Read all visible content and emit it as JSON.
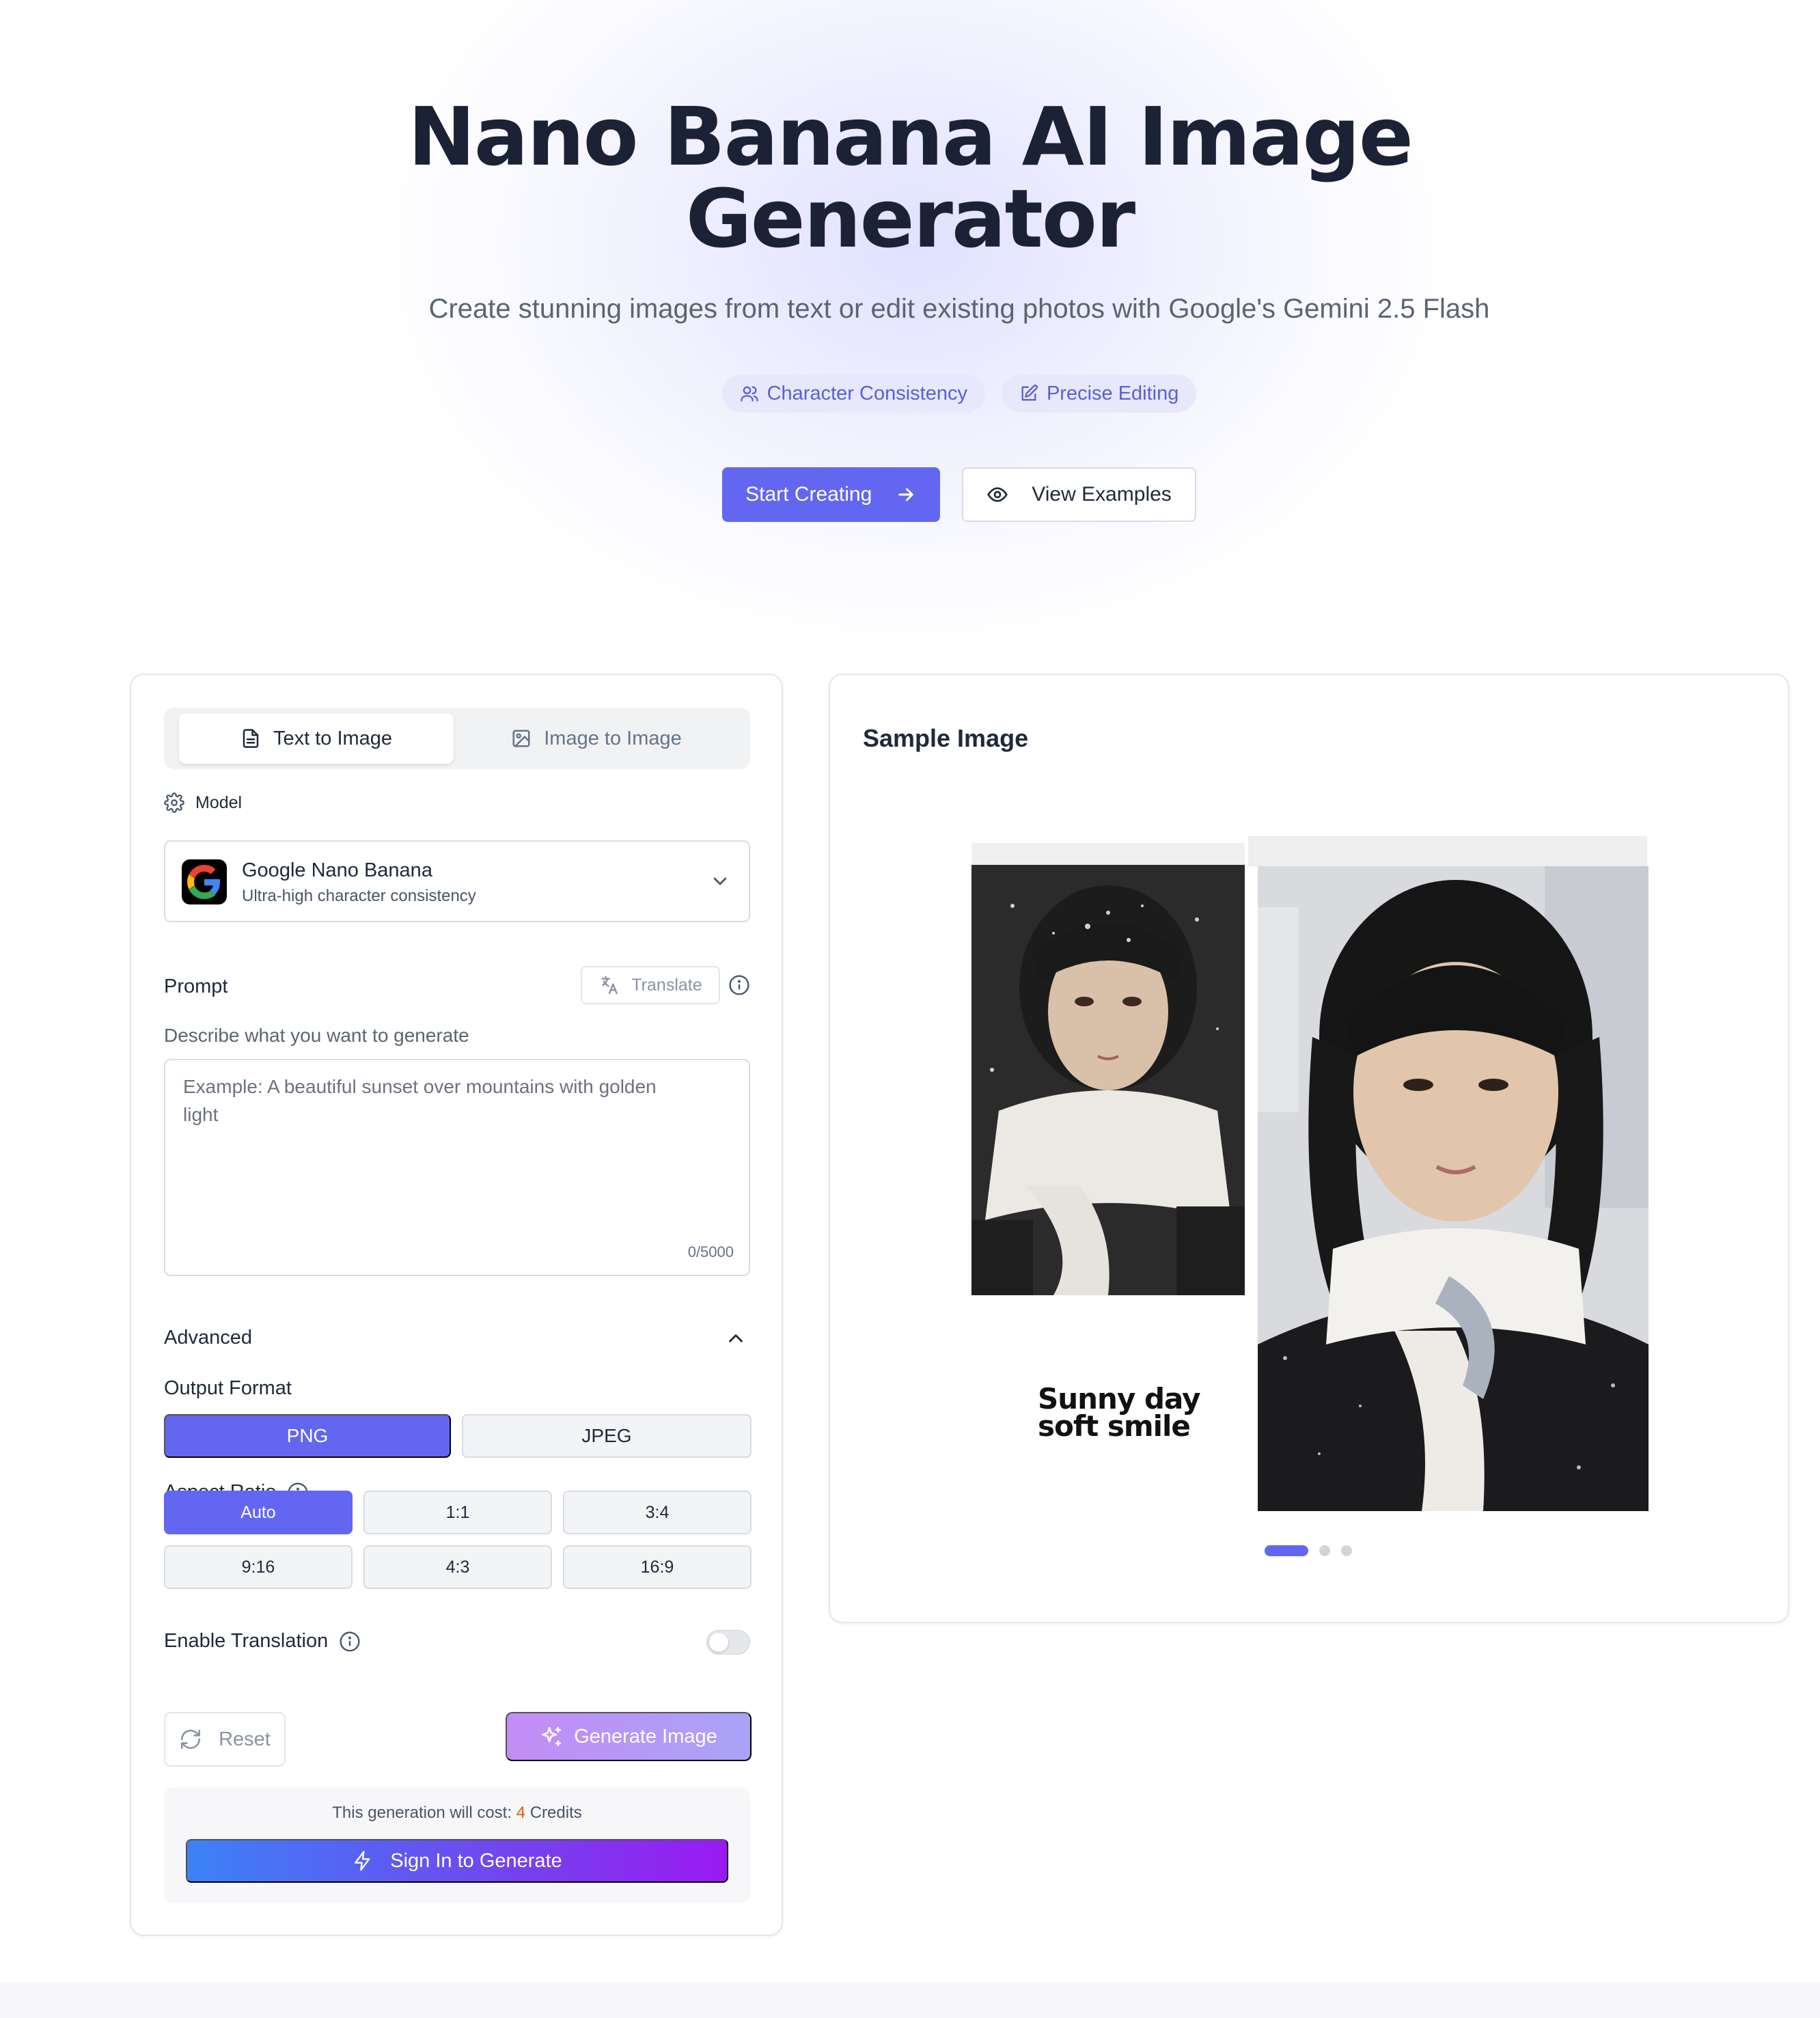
{
  "hero": {
    "title_line1": "Nano Banana AI Image",
    "title_line2": "Generator",
    "subtitle": "Create stunning images from text or edit existing photos with Google's Gemini 2.5 Flash",
    "badges": [
      "Character Consistency",
      "Precise Editing"
    ],
    "start_label": "Start Creating",
    "examples_label": "View Examples"
  },
  "tabs": [
    "Text to Image",
    "Image to Image"
  ],
  "model": {
    "label": "Model",
    "name": "Google Nano Banana",
    "description": "Ultra-high character consistency"
  },
  "prompt": {
    "label": "Prompt",
    "translate_label": "Translate",
    "hint": "Describe what you want to generate",
    "placeholder": "Example: A beautiful sunset over mountains with golden light",
    "counter": "0/5000"
  },
  "advanced": {
    "label": "Advanced",
    "output_format_label": "Output Format",
    "formats": [
      "PNG",
      "JPEG"
    ],
    "selected_format": "PNG",
    "aspect_ratio_label": "Aspect Ratio",
    "aspect_ratios": [
      "Auto",
      "1:1",
      "3:4",
      "9:16",
      "4:3",
      "16:9"
    ],
    "selected_ratio": "Auto",
    "translation_label": "Enable Translation",
    "translation_enabled": false
  },
  "actions": {
    "reset_label": "Reset",
    "generate_label": "Generate Image",
    "cost_prefix": "This generation will cost:",
    "cost_amount": "4",
    "cost_suffix": "Credits",
    "signin_label": "Sign In to Generate"
  },
  "sample": {
    "title": "Sample Image",
    "caption_line1": "Sunny day",
    "caption_line2": "soft smile",
    "slide_count": 3,
    "active_slide": 1
  },
  "colors": {
    "accent": "#6366f1",
    "cost_highlight": "#ea580c"
  }
}
